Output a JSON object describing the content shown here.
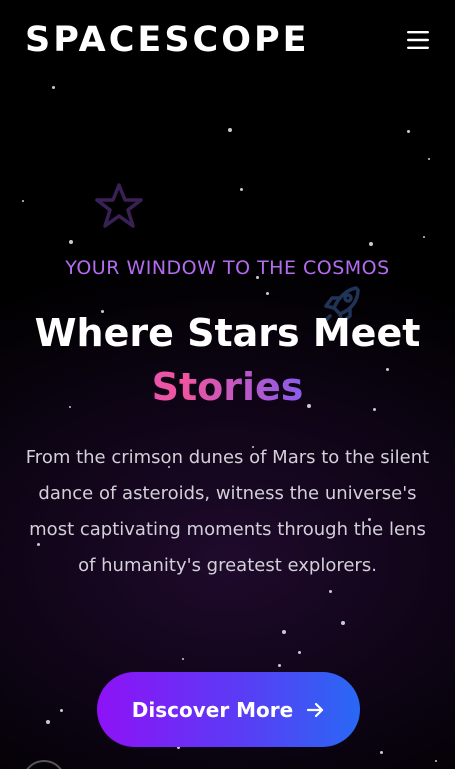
{
  "header": {
    "brand": "SPACESCOPE",
    "menu_icon": "hamburger-menu-icon"
  },
  "decorations": {
    "star_icon": "star-outline-icon",
    "rocket_icon": "rocket-icon"
  },
  "hero": {
    "tagline": "YOUR WINDOW TO THE COSMOS",
    "headline": "Where Stars Meet",
    "headline_accent": "Stories",
    "description": "From the crimson dunes of Mars to the silent dance of asteroids, witness the universe's most captivating moments through the lens of humanity's greatest explorers.",
    "cta_label": "Discover More",
    "cta_icon": "arrow-right-icon"
  },
  "colors": {
    "background": "#000000",
    "tagline": "#b36cf0",
    "accent_gradient_start": "#8e12f6",
    "accent_gradient_end": "#2968f4",
    "description_text": "#d3d0d8"
  }
}
